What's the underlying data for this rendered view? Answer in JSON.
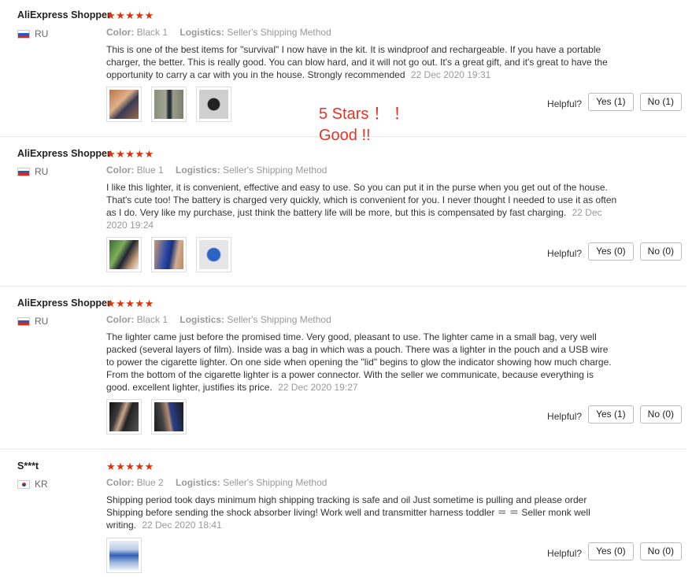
{
  "annotation": {
    "line1": "5 Stars ！ ！",
    "line2": "Good !!"
  },
  "helpful_label": "Helpful?",
  "reviews": [
    {
      "user": "AliExpress Shopper",
      "stars": "★★★★★",
      "rating": 5,
      "country_code": "RU",
      "color_label": "Color:",
      "color_value": "Black 1",
      "logistics_label": "Logistics:",
      "logistics_value": "Seller's Shipping Method",
      "text": "This is one of the best items for \"survival\" I now have in the kit. It is windproof and rechargeable. If you have a portable charger, the better. This is really good. You can blow hard, and it will not go out. It's a great gift, and it's great to have the opportunity to carry a car with you in the house. Strongly recommended",
      "date": "22 Dec 2020 19:31",
      "yes": "Yes (1)",
      "no": "No (1)",
      "photos": [
        "photo-hand-lighter",
        "photo-lighter-black",
        "photo-lighter-dark"
      ]
    },
    {
      "user": "AliExpress Shopper",
      "stars": "★★★★★",
      "rating": 5,
      "country_code": "RU",
      "color_label": "Color:",
      "color_value": "Blue 1",
      "logistics_label": "Logistics:",
      "logistics_value": "Seller's Shipping Method",
      "text": "I like this lighter, it is convenient, effective and easy to use. So you can put it in the purse when you get out of the house. That's cute too! The battery is charged very quickly, which is convenient for you. I never thought I needed to use it as often as I do. Very like my purchase, just think the battery life will be more, but this is compensated by fast charging.",
      "date": "22 Dec 2020 19:24",
      "yes": "Yes (0)",
      "no": "No (0)",
      "photos": [
        "photo-green-hand",
        "photo-blue-lighter",
        "photo-blue-box"
      ]
    },
    {
      "user": "AliExpress Shopper",
      "stars": "★★★★★",
      "rating": 5,
      "country_code": "RU",
      "color_label": "Color:",
      "color_value": "Black 1",
      "logistics_label": "Logistics:",
      "logistics_value": "Seller's Shipping Method",
      "text": "The lighter came just before the promised time. Very good, pleasant to use. The lighter came in a small bag, very well packed (several layers of film). Inside was a bag in which was a pouch. There was a lighter in the pouch and a USB wire to power the cigarette lighter. On one side when opening the \"lid\" begins to glow the indicator showing how much charge. From the bottom of the cigarette lighter is a power connector. With the seller we communicate, because everything is good. excellent lighter, justifies its price.",
      "date": "22 Dec 2020 19:27",
      "yes": "Yes (1)",
      "no": "No (0)",
      "photos": [
        "photo-car-lighter",
        "photo-car-hand"
      ]
    },
    {
      "user": "S***t",
      "stars": "★★★★★",
      "rating": 5,
      "country_code": "KR",
      "color_label": "Color:",
      "color_value": "Blue 2",
      "logistics_label": "Logistics:",
      "logistics_value": "Seller's Shipping Method",
      "text": "Shipping period took days minimum high shipping tracking is safe and oil Just sometime is pulling and please order Shipping before sending the shock absorber living! Work well and transmitter harness toddler ＝ ＝ Seller monk well writing.",
      "date": "22 Dec 2020 18:41",
      "yes": "Yes (0)",
      "no": "No (0)",
      "photos": [
        "photo-blue-package"
      ]
    }
  ],
  "colors": {
    "star": "#e62e04",
    "annotation": "#e63228",
    "meta": "#999999"
  }
}
